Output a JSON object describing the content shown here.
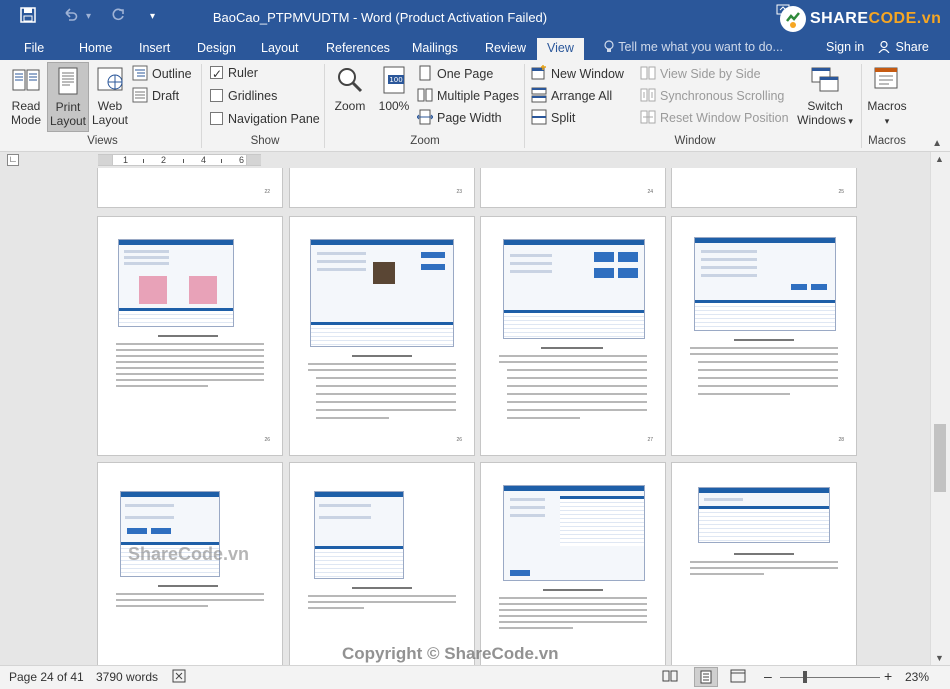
{
  "titlebar": {
    "title": "BaoCao_PTPMVUDTM - Word (Product Activation Failed)",
    "logo_text_a": "SHARE",
    "logo_text_b": "CODE.vn"
  },
  "tabs": [
    "File",
    "Home",
    "Insert",
    "Design",
    "Layout",
    "References",
    "Mailings",
    "Review",
    "View"
  ],
  "active_tab": "View",
  "tellme_placeholder": "Tell me what you want to do...",
  "signin_label": "Sign in",
  "share_label": "Share",
  "ribbon": {
    "views": {
      "label": "Views",
      "read_mode": [
        "Read",
        "Mode"
      ],
      "print_layout": [
        "Print",
        "Layout"
      ],
      "web_layout": [
        "Web",
        "Layout"
      ],
      "outline": "Outline",
      "draft": "Draft"
    },
    "show": {
      "label": "Show",
      "ruler": "Ruler",
      "gridlines": "Gridlines",
      "navigation_pane": "Navigation Pane",
      "ruler_checked": true,
      "gridlines_checked": false,
      "navigation_checked": false
    },
    "zoom": {
      "label": "Zoom",
      "zoom": "Zoom",
      "hundred": "100%",
      "one_page": "One Page",
      "multiple_pages": "Multiple Pages",
      "page_width": "Page Width"
    },
    "window": {
      "label": "Window",
      "new_window": "New Window",
      "arrange_all": "Arrange All",
      "split": "Split",
      "view_side_by_side": "View Side by Side",
      "synchronous_scrolling": "Synchronous Scrolling",
      "reset_window_position": "Reset Window Position",
      "switch_windows": [
        "Switch",
        "Windows"
      ]
    },
    "macros": {
      "label": "Macros",
      "macros": "Macros"
    }
  },
  "ruler_numbers": [
    "1",
    "2",
    "4",
    "6"
  ],
  "pages": {
    "row1_numbers": [
      "22",
      "23",
      "24",
      "25"
    ],
    "row2_numbers": [
      "26",
      "26",
      "27",
      "28"
    ]
  },
  "statusbar": {
    "page_info": "Page 24 of 41",
    "words": "3790 words",
    "zoom_percent": "23%",
    "zoom_minus": "–",
    "zoom_plus": "+"
  },
  "watermarks": {
    "center": "ShareCode.vn",
    "bottom": "Copyright © ShareCode.vn"
  },
  "colors": {
    "word_blue": "#2b579a",
    "ribbon_bg": "#f3f3f3",
    "canvas_bg": "#e6e6e6"
  }
}
